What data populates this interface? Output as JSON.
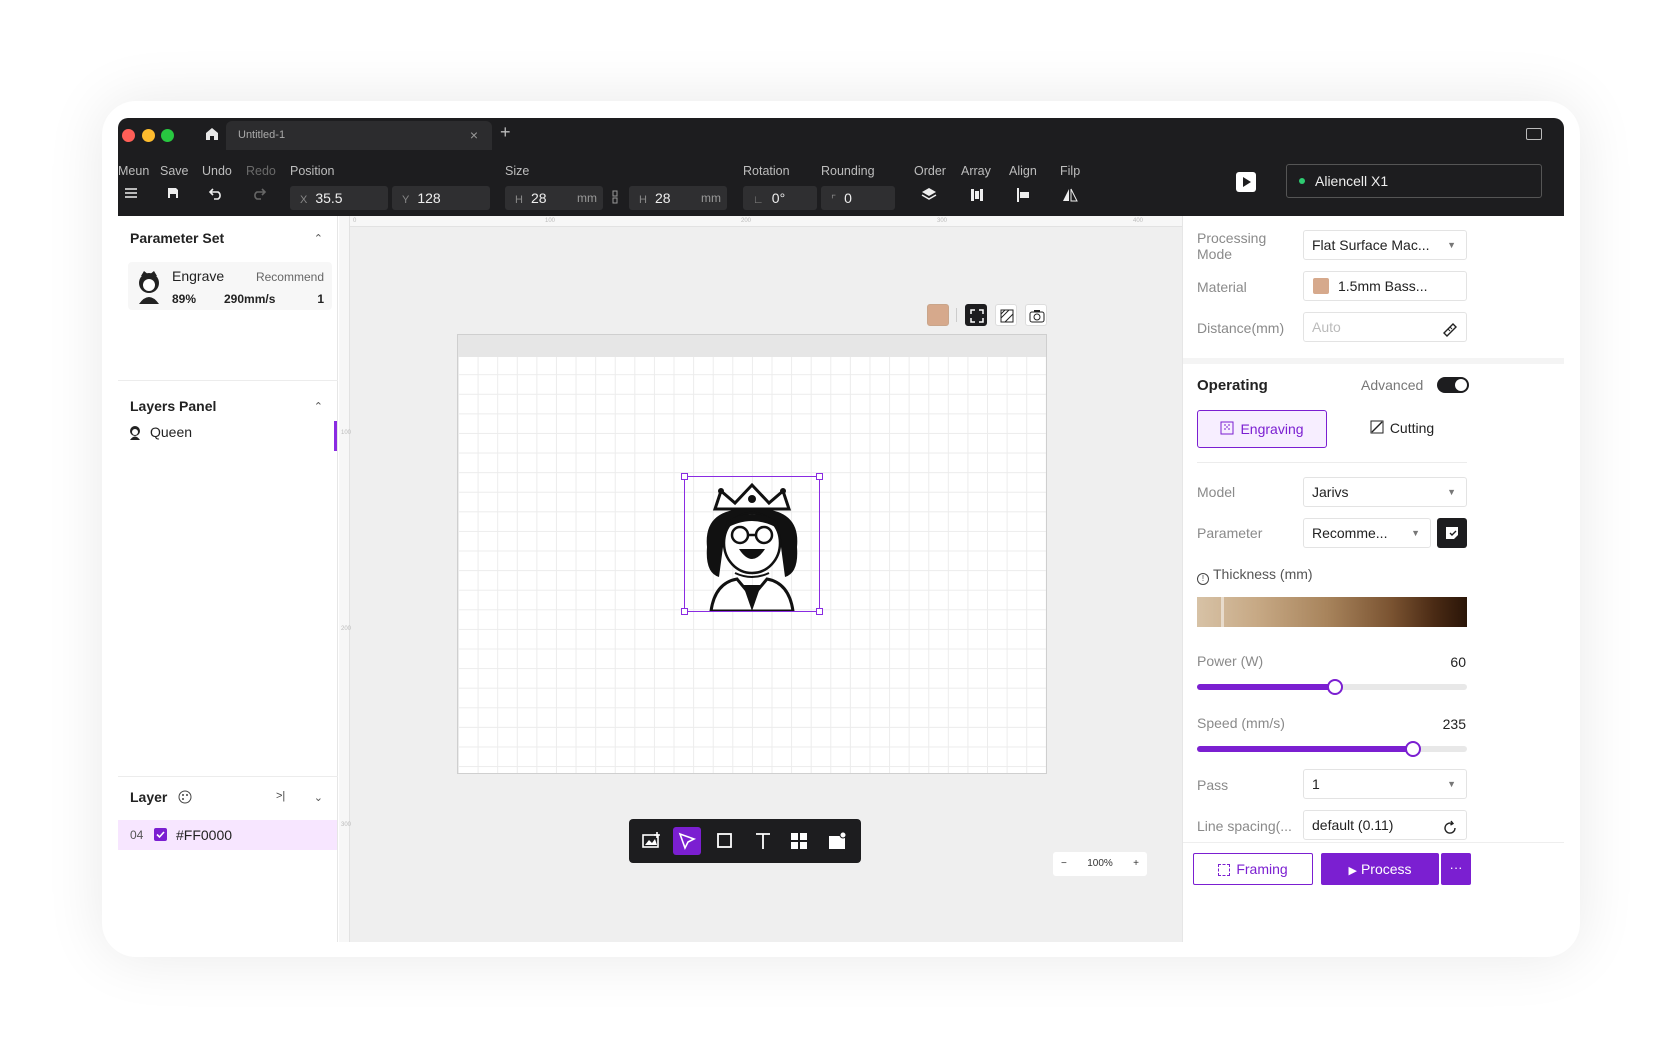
{
  "titlebar": {
    "tab_title": "Untitled-1"
  },
  "toolbar": {
    "menu_label": "Meun",
    "save_label": "Save",
    "undo_label": "Undo",
    "redo_label": "Redo",
    "position_label": "Position",
    "pos_x_prefix": "X",
    "pos_x": "35.5",
    "pos_y_prefix": "Y",
    "pos_y": "128",
    "size_label": "Size",
    "size_w_prefix": "H",
    "size_w": "28",
    "size_w_unit": "mm",
    "size_h_prefix": "H",
    "size_h": "28",
    "size_h_unit": "mm",
    "rotation_label": "Rotation",
    "rotation": "0°",
    "rounding_label": "Rounding",
    "rounding": "0",
    "order_label": "Order",
    "array_label": "Array",
    "align_label": "Align",
    "flip_label": "Filp",
    "device_name": "Aliencell X1"
  },
  "left": {
    "parameter_set_title": "Parameter Set",
    "param_card": {
      "name": "Engrave",
      "tag": "Recommend",
      "power": "89%",
      "speed": "290mm/s",
      "pass": "1"
    },
    "layers_panel_title": "Layers Panel",
    "layers": [
      {
        "name": "Queen"
      }
    ],
    "layer_title": "Layer",
    "layer_row": {
      "index": "04",
      "color": "#FF0000"
    }
  },
  "canvas": {
    "zoom": "100%",
    "ruler_top": [
      "100",
      "200",
      "300",
      "400"
    ],
    "ruler_left": [
      "100",
      "200",
      "300"
    ]
  },
  "right": {
    "processing_mode_label": "Processing Mode",
    "processing_mode": "Flat Surface Mac...",
    "material_label": "Material",
    "material": "1.5mm Bass...",
    "distance_label": "Distance(mm)",
    "distance_placeholder": "Auto",
    "operating_title": "Operating",
    "advanced_label": "Advanced",
    "engraving_label": "Engraving",
    "cutting_label": "Cutting",
    "model_label": "Model",
    "model": "Jarivs",
    "parameter_label": "Parameter",
    "parameter": "Recomme...",
    "thickness_label": "Thickness",
    "thickness_unit": "(mm)",
    "power_label": "Power",
    "power_unit": "(W)",
    "power_value": "60",
    "power_fraction": 0.51,
    "speed_label": "Speed",
    "speed_unit": "(mm/s)",
    "speed_value": "235",
    "speed_fraction": 0.8,
    "pass_label": "Pass",
    "pass": "1",
    "line_spacing_label": "Line spacing(...",
    "line_spacing": "default (0.11)",
    "framing_label": "Framing",
    "process_label": "Process",
    "more_label": "···"
  },
  "colors": {
    "accent": "#7b1fd1",
    "dark": "#1d1d1f",
    "material_swatch": "#d6a98c"
  }
}
